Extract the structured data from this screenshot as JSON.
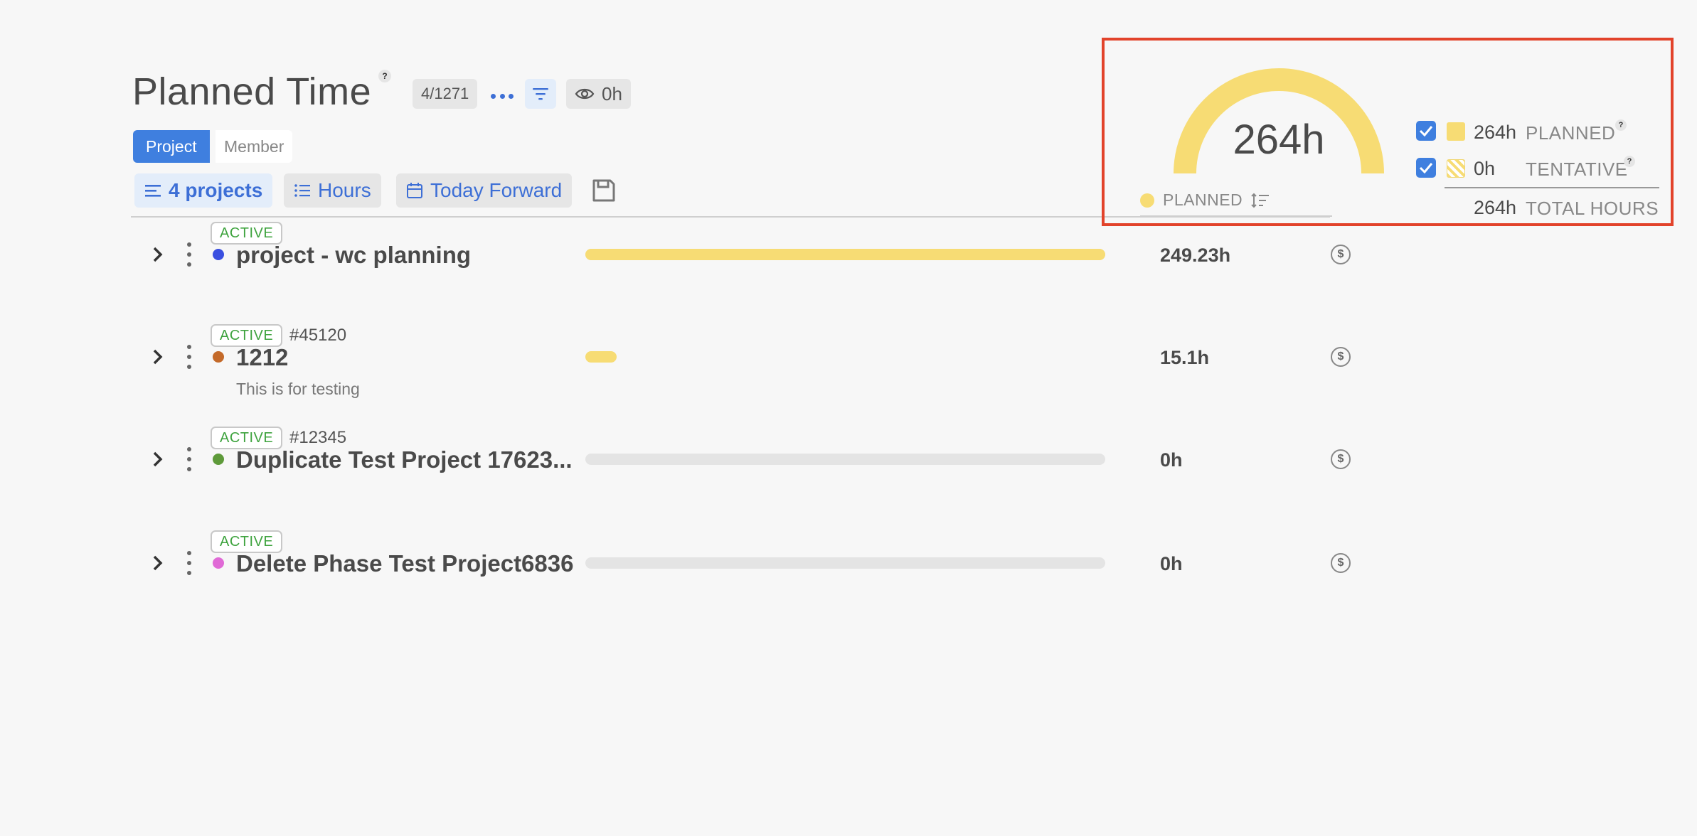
{
  "header": {
    "title": "Planned Time",
    "help_mark": "?",
    "count": "4/1271",
    "eye_value": "0h"
  },
  "view_tabs": [
    {
      "label": "Project",
      "active": true
    },
    {
      "label": "Member",
      "active": false
    }
  ],
  "toolbar": {
    "projects_label": "4 projects",
    "hours_label": "Hours",
    "date_range_label": "Today Forward"
  },
  "projects": [
    {
      "status": "ACTIVE",
      "id": "",
      "name": "project - wc planning",
      "description": "",
      "dot_color": "#3a4fe0",
      "planned_fraction": 1.0,
      "hours": "249.23h"
    },
    {
      "status": "ACTIVE",
      "id": "#45120",
      "name": "1212",
      "description": "This is for testing",
      "dot_color": "#c46a2a",
      "planned_fraction": 0.06,
      "hours": "15.1h"
    },
    {
      "status": "ACTIVE",
      "id": "#12345",
      "name": "Duplicate Test Project 17623...",
      "description": "",
      "dot_color": "#5e9a3a",
      "planned_fraction": 0,
      "hours": "0h"
    },
    {
      "status": "ACTIVE",
      "id": "",
      "name": "Delete Phase Test Project6836",
      "description": "",
      "dot_color": "#e06ad6",
      "planned_fraction": 0,
      "hours": "0h"
    }
  ],
  "billing_icon": "$",
  "summary": {
    "gauge_value": "264h",
    "gauge_legend": "PLANNED",
    "planned_value": "264h",
    "planned_label": "PLANNED",
    "tentative_value": "0h",
    "tentative_label": "TENTATIVE",
    "total_value": "264h",
    "total_label": "TOTAL HOURS",
    "planned_color": "#f7dc74"
  },
  "colors": {
    "accent": "#3f7fdf",
    "active_badge": "#3ea33e",
    "highlight_border": "#e2432b"
  }
}
